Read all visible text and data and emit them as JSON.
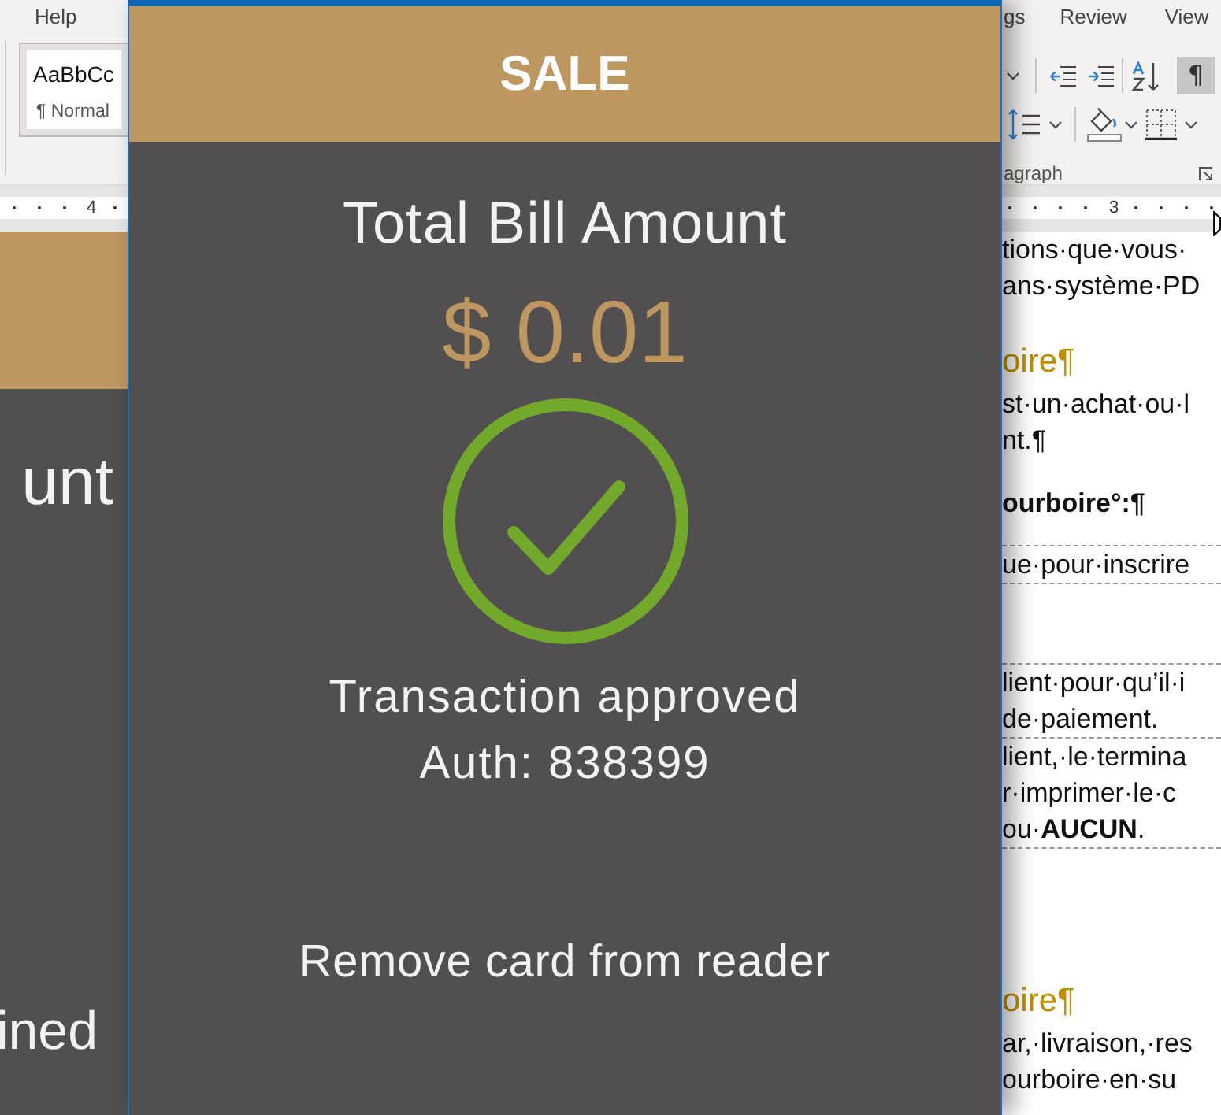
{
  "word_window": {
    "left_ribbon": {
      "tab": {
        "label": "Help",
        "selected": false
      },
      "style_gallery": {
        "preview": "AaBbCc",
        "style_name": "¶ Normal"
      },
      "ruler_number": "4"
    },
    "right_ribbon": {
      "tabs": [
        {
          "label": "gs",
          "selected": false
        },
        {
          "label": "Review",
          "selected": false
        },
        {
          "label": "View",
          "selected": false
        }
      ],
      "show_marks_button": {
        "label": "¶",
        "selected": true
      },
      "group_label": "agraph",
      "ruler_number": "3"
    },
    "document": {
      "lines": [
        {
          "kind": "text",
          "text": "tions·que·vous·"
        },
        {
          "kind": "text",
          "text": "ans·système·PD"
        },
        {
          "kind": "heading",
          "text": "oire¶"
        },
        {
          "kind": "text",
          "text": "st·un·achat·ou·l"
        },
        {
          "kind": "text",
          "text": "nt.¶"
        },
        {
          "kind": "label",
          "text": "ourboire°:¶"
        },
        {
          "kind": "divider"
        },
        {
          "kind": "text",
          "text": "ue·pour·inscrire"
        },
        {
          "kind": "divider"
        },
        {
          "kind": "divider"
        },
        {
          "kind": "text",
          "text": "lient·pour·qu’il·i"
        },
        {
          "kind": "text",
          "text": "de·paiement."
        },
        {
          "kind": "divider"
        },
        {
          "kind": "text",
          "text": "lient,·le·termina"
        },
        {
          "kind": "text",
          "text": "r·imprimer·le·c"
        },
        {
          "kind": "text",
          "text": "ou·**AUCUN**."
        },
        {
          "kind": "divider"
        },
        {
          "kind": "heading",
          "text": "oire¶"
        },
        {
          "kind": "text",
          "text": "ar,·livraison,·res"
        },
        {
          "kind": "text",
          "text": "ourboire·en·su"
        }
      ]
    }
  },
  "background_sale_window": {
    "upper_text": "unt",
    "lower_text": "ined"
  },
  "sale_window": {
    "title": "SALE",
    "total_label": "Total Bill Amount",
    "amount": "$ 0.01",
    "message": "Transaction approved",
    "auth": "Auth: 838399",
    "instruction": "Remove card from reader"
  }
}
